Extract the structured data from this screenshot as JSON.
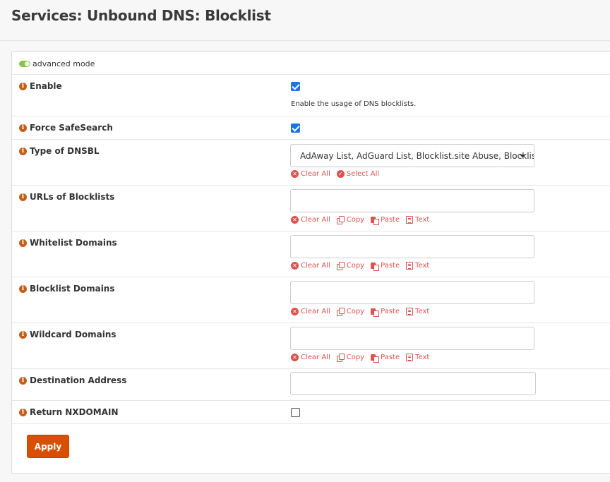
{
  "page": {
    "title": "Services: Unbound DNS: Blocklist"
  },
  "advanced_mode": {
    "label": "advanced mode"
  },
  "fields": {
    "enable": {
      "label": "Enable",
      "checked": true,
      "help": "Enable the usage of DNS blocklists."
    },
    "force_safesearch": {
      "label": "Force SafeSearch",
      "checked": true
    },
    "type_of_dnsbl": {
      "label": "Type of DNSBL",
      "value": "AdAway List, AdGuard List, Blocklist.site Abuse, Blocklist.site Ads"
    },
    "urls_of_blocklists": {
      "label": "URLs of Blocklists",
      "value": ""
    },
    "whitelist_domains": {
      "label": "Whitelist Domains",
      "value": ""
    },
    "blocklist_domains": {
      "label": "Blocklist Domains",
      "value": ""
    },
    "wildcard_domains": {
      "label": "Wildcard Domains",
      "value": ""
    },
    "destination_address": {
      "label": "Destination Address",
      "value": ""
    },
    "return_nxdomain": {
      "label": "Return NXDOMAIN",
      "checked": false
    }
  },
  "actions": {
    "clear_all": "Clear All",
    "select_all": "Select All",
    "copy": "Copy",
    "paste": "Paste",
    "text": "Text"
  },
  "buttons": {
    "apply": "Apply"
  },
  "colors": {
    "accent": "#d94f00",
    "info_icon": "#c55e17",
    "action_red": "#d9534f",
    "checkbox_blue": "#1a73e8",
    "toggle_green": "#8bc34a"
  },
  "icons": {
    "info": "info-circle-icon",
    "clear_all": "x-circle-icon",
    "select_all": "check-circle-icon",
    "copy": "copy-icon",
    "paste": "paste-icon",
    "text": "text-file-icon",
    "dropdown": "caret-down-icon",
    "advanced_mode": "toggle-icon"
  }
}
